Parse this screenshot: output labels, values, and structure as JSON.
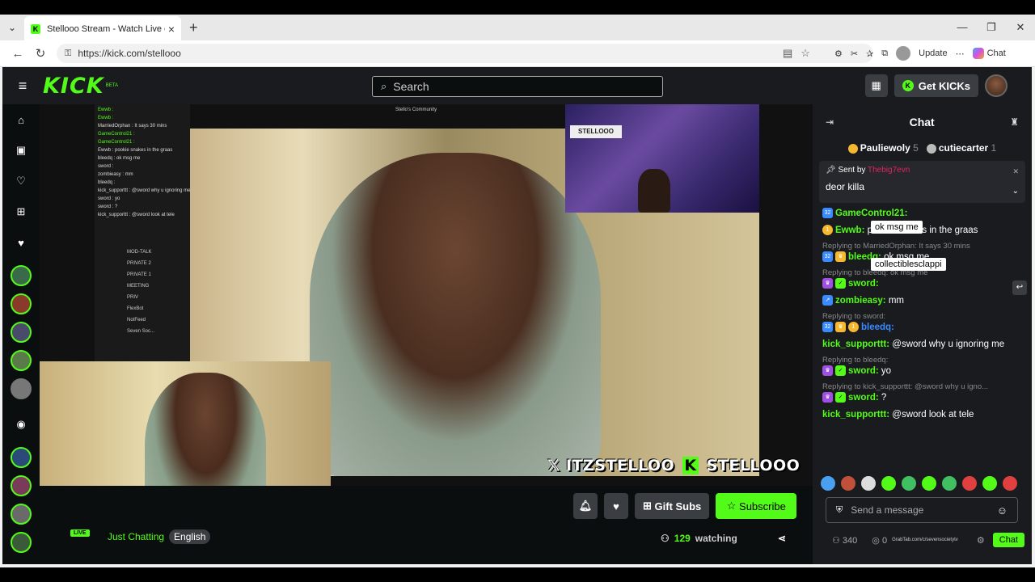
{
  "browser": {
    "tab_title": "Stellooo Stream - Watch Live on K",
    "tab_close": "×",
    "new_tab": "+",
    "tab_dropdown": "⌄",
    "window_controls": [
      "—",
      "❐",
      "✕"
    ],
    "url": "https://kick.com/stellooo",
    "update_label": "Update",
    "more": "⋯",
    "chat_label": "Chat"
  },
  "site": {
    "logo": "KICK",
    "beta": "BETA",
    "search_placeholder": "Search",
    "get_kicks": "Get KICKs",
    "accent": "#53fc18"
  },
  "player": {
    "community": "Stello's Community",
    "handle_twitter": "ITZSTELLOO",
    "handle_kick": "STELLOOO",
    "poster_text": "STELLOOO",
    "overlay_chat": [
      "Ewwb :",
      "Ewwb :",
      "MarriedOrphan : It says 30 mins",
      "GameControl21 :",
      "GameControl21 :",
      "Ewwb : pookie snakes in the graas",
      "bleedq : ok msg me",
      "sword :",
      "zombieasy : mm",
      "bleedq :",
      "kick_supporttt : @sword why u ignoring me",
      "sword : yo",
      "sword : ?",
      "kick_supporttt : @sword look at tele"
    ],
    "overlay_menu": [
      "MOD-TALK",
      "PRIVATE 2",
      "PRIVATE 1",
      "MEETING",
      "PRIV",
      "FlexBot",
      "NotFeed",
      "Seven Soc..."
    ]
  },
  "stream": {
    "live": "LIVE",
    "category": "Just Chatting",
    "language": "English",
    "gift_subs": "Gift Subs",
    "subscribe": "Subscribe",
    "watching_count": "129",
    "watching_label": "watching"
  },
  "chat": {
    "title": "Chat",
    "gifters": [
      {
        "name": "Pauliewoly",
        "count": "5",
        "color": "#f5b82e"
      },
      {
        "name": "cutiecarter",
        "count": "1",
        "color": "#bbbbbb"
      }
    ],
    "pinned_by_prefix": "Sent by",
    "pinned_by": "Thebig7evn",
    "pinned_message": "deor killa",
    "messages": [
      {
        "user": "GameControl21:",
        "color": "#53fc18",
        "text": "",
        "reply": ""
      },
      {
        "user": "Ewwb:",
        "color": "#53fc18",
        "text": "pookie snakes in the graas",
        "reply": ""
      },
      {
        "user": "bleedq:",
        "color": "#53fc18",
        "text": "ok msg me",
        "reply": "Replying to MarriedOrphan: It says 30 mins"
      },
      {
        "user": "sword:",
        "color": "#53fc18",
        "text": "",
        "reply": "Replying to bleedq: ok msg me"
      },
      {
        "user": "zombieasy:",
        "color": "#53fc18",
        "text": "mm",
        "reply": ""
      },
      {
        "user": "bleedq:",
        "color": "#3a8bff",
        "text": "",
        "reply": "Replying to sword:"
      },
      {
        "user": "kick_supporttt:",
        "color": "#53fc18",
        "text": "@sword why u ignoring me",
        "reply": ""
      },
      {
        "user": "sword:",
        "color": "#53fc18",
        "text": "yo",
        "reply": "Replying to bleedq:"
      },
      {
        "user": "sword:",
        "color": "#53fc18",
        "text": "?",
        "reply": "Replying to kick_supporttt: @sword why u igno..."
      },
      {
        "user": "kick_supporttt:",
        "color": "#53fc18",
        "text": "@sword look at tele",
        "reply": ""
      }
    ],
    "tooltip_1": "ok msg me",
    "tooltip_2": "collectiblesclappi",
    "send_placeholder": "Send a message",
    "viewer_count": "340",
    "kicks_count": "0",
    "grab_text": "GrabTab.com/c/sevensocietytv",
    "chat_button": "Chat"
  }
}
